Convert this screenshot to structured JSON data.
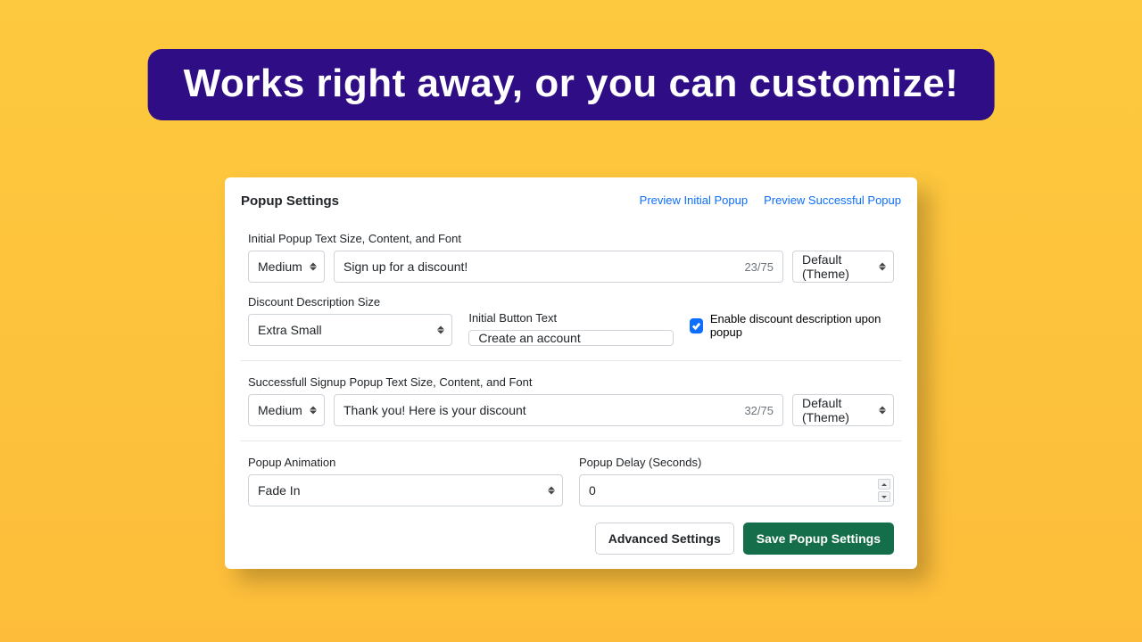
{
  "banner": "Works right away, or you can customize!",
  "card": {
    "title": "Popup Settings",
    "links": {
      "preview_initial": "Preview Initial Popup",
      "preview_success": "Preview Successful Popup"
    }
  },
  "initial": {
    "section_label": "Initial Popup Text Size, Content, and Font",
    "size": "Medium",
    "content": "Sign up for a discount!",
    "counter": "23/75",
    "font": "Default (Theme)"
  },
  "desc": {
    "label": "Discount Description Size",
    "value": "Extra Small"
  },
  "button_text": {
    "label": "Initial Button Text",
    "value": "Create an account"
  },
  "toggle": {
    "label": "Enable discount description upon popup",
    "checked": true
  },
  "success": {
    "section_label": "Successfull Signup Popup Text Size, Content, and Font",
    "size": "Medium",
    "content": "Thank you! Here is your discount",
    "counter": "32/75",
    "font": "Default (Theme)"
  },
  "animation": {
    "label": "Popup Animation",
    "value": "Fade In"
  },
  "delay": {
    "label": "Popup Delay (Seconds)",
    "value": "0"
  },
  "footer": {
    "advanced": "Advanced Settings",
    "save": "Save Popup Settings"
  }
}
